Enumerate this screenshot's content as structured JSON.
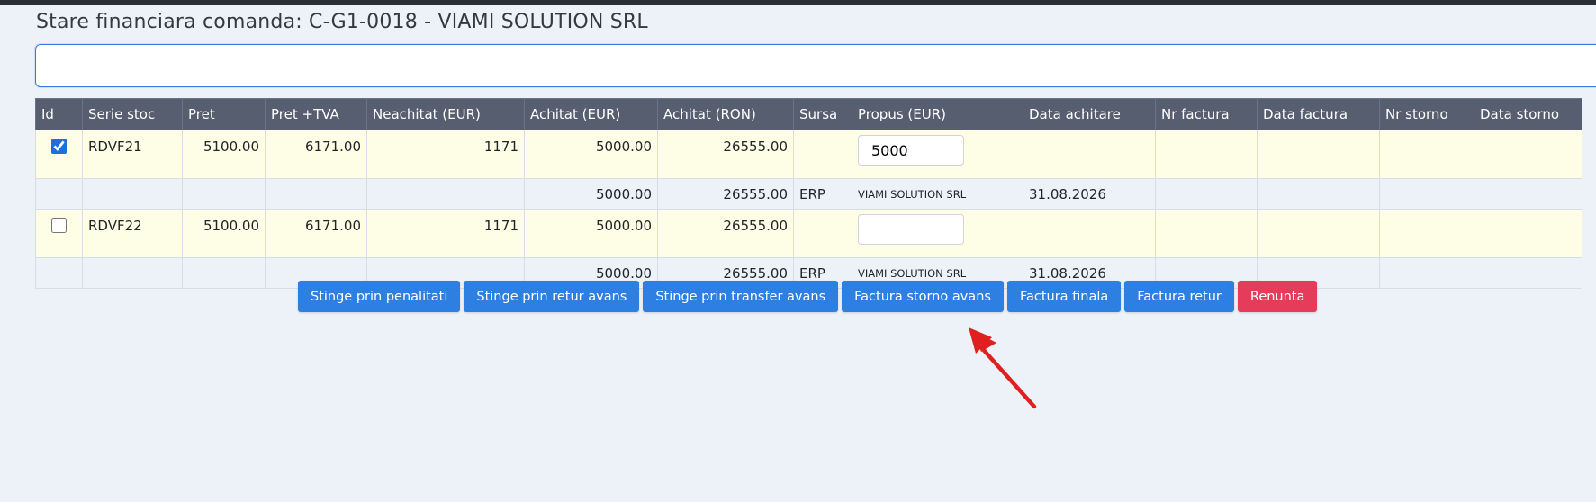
{
  "page": {
    "title": "Stare financiara comanda: C-G1-0018 - VIAMI SOLUTION SRL"
  },
  "search": {
    "value": ""
  },
  "table": {
    "columns": [
      "Id",
      "Serie stoc",
      "Pret",
      "Pret +TVA",
      "Neachitat (EUR)",
      "Achitat (EUR)",
      "Achitat (RON)",
      "Sursa",
      "Propus (EUR)",
      "Data achitare",
      "Nr factura",
      "Data factura",
      "Nr storno",
      "Data storno"
    ],
    "rows": [
      {
        "checked": true,
        "serie_stoc": "RDVF21",
        "pret": "5100.00",
        "pret_tva": "6171.00",
        "neachitat": "1171",
        "achitat_eur": "5000.00",
        "achitat_ron": "26555.00",
        "propus": "5000",
        "payment": {
          "achitat_eur": "5000.00",
          "achitat_ron": "26555.00",
          "sursa": "ERP",
          "client": "VIAMI SOLUTION SRL",
          "data_achitare": "31.08.2026"
        }
      },
      {
        "checked": false,
        "serie_stoc": "RDVF22",
        "pret": "5100.00",
        "pret_tva": "6171.00",
        "neachitat": "1171",
        "achitat_eur": "5000.00",
        "achitat_ron": "26555.00",
        "propus": "",
        "payment": {
          "achitat_eur": "5000.00",
          "achitat_ron": "26555.00",
          "sursa": "ERP",
          "client": "VIAMI SOLUTION SRL",
          "data_achitare": "31.08.2026"
        }
      }
    ]
  },
  "actions": {
    "stinge_penalitati": "Stinge prin penalitati",
    "stinge_retur_avans": "Stinge prin retur avans",
    "stinge_transfer_avans": "Stinge prin transfer avans",
    "factura_storno_avans": "Factura storno avans",
    "factura_finala": "Factura finala",
    "factura_retur": "Factura retur",
    "renunta": "Renunta"
  },
  "colors": {
    "primary": "#2d7fe1",
    "danger": "#e43c59",
    "header": "#565e6f",
    "row_highlight": "#fefee6",
    "annotation_arrow": "#e02020"
  },
  "icons": {
    "annotation": "red-arrow-icon"
  }
}
